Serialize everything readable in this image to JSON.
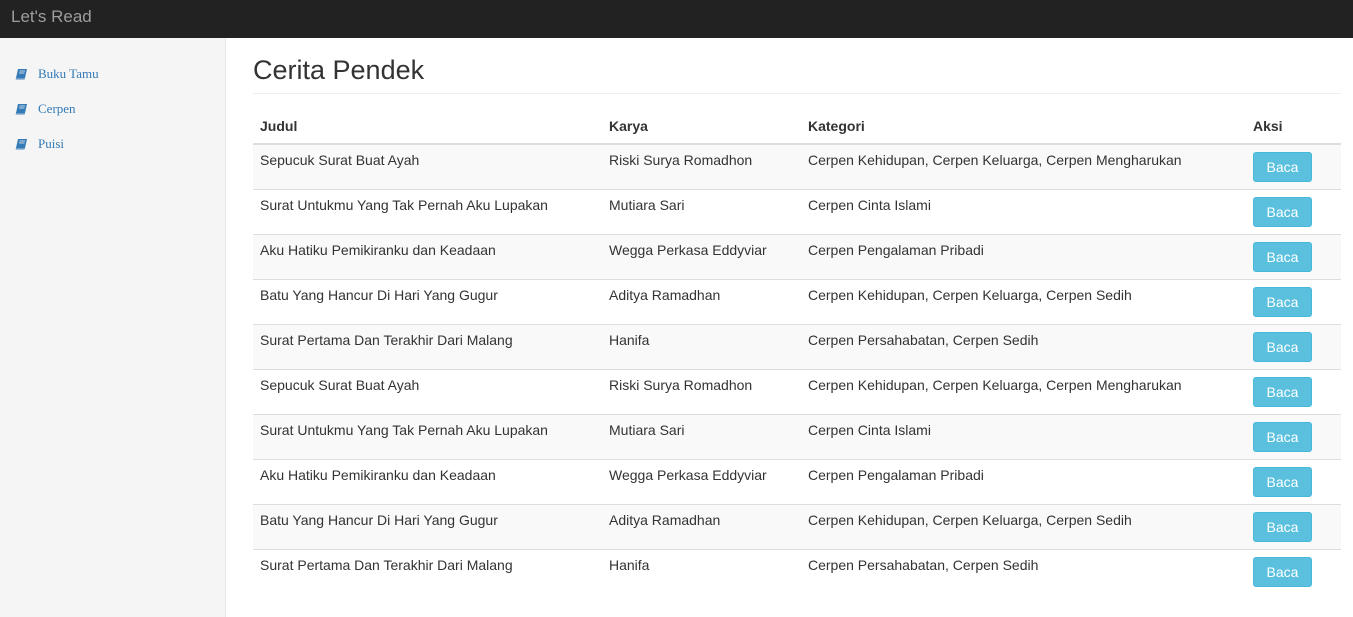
{
  "navbar": {
    "brand": "Let's Read"
  },
  "sidebar": {
    "items": [
      {
        "label": "Buku Tamu",
        "icon": "book-icon"
      },
      {
        "label": "Cerpen",
        "icon": "book-icon"
      },
      {
        "label": "Puisi",
        "icon": "book-icon"
      }
    ]
  },
  "main": {
    "title": "Cerita Pendek",
    "table": {
      "headers": {
        "judul": "Judul",
        "karya": "Karya",
        "kategori": "Kategori",
        "aksi": "Aksi"
      },
      "rows": [
        {
          "judul": "Sepucuk Surat Buat Ayah",
          "karya": "Riski Surya Romadhon",
          "kategori": "Cerpen Kehidupan, Cerpen Keluarga, Cerpen Mengharukan",
          "aksi": "Baca"
        },
        {
          "judul": "Surat Untukmu Yang Tak Pernah Aku Lupakan",
          "karya": "Mutiara Sari",
          "kategori": "Cerpen Cinta Islami",
          "aksi": "Baca"
        },
        {
          "judul": "Aku Hatiku Pemikiranku dan Keadaan",
          "karya": "Wegga Perkasa Eddyviar",
          "kategori": "Cerpen Pengalaman Pribadi",
          "aksi": "Baca"
        },
        {
          "judul": "Batu Yang Hancur Di Hari Yang Gugur",
          "karya": "Aditya Ramadhan",
          "kategori": "Cerpen Kehidupan, Cerpen Keluarga, Cerpen Sedih",
          "aksi": "Baca"
        },
        {
          "judul": "Surat Pertama Dan Terakhir Dari Malang",
          "karya": "Hanifa",
          "kategori": "Cerpen Persahabatan, Cerpen Sedih",
          "aksi": "Baca"
        },
        {
          "judul": "Sepucuk Surat Buat Ayah",
          "karya": "Riski Surya Romadhon",
          "kategori": "Cerpen Kehidupan, Cerpen Keluarga, Cerpen Mengharukan",
          "aksi": "Baca"
        },
        {
          "judul": "Surat Untukmu Yang Tak Pernah Aku Lupakan",
          "karya": "Mutiara Sari",
          "kategori": "Cerpen Cinta Islami",
          "aksi": "Baca"
        },
        {
          "judul": "Aku Hatiku Pemikiranku dan Keadaan",
          "karya": "Wegga Perkasa Eddyviar",
          "kategori": "Cerpen Pengalaman Pribadi",
          "aksi": "Baca"
        },
        {
          "judul": "Batu Yang Hancur Di Hari Yang Gugur",
          "karya": "Aditya Ramadhan",
          "kategori": "Cerpen Kehidupan, Cerpen Keluarga, Cerpen Sedih",
          "aksi": "Baca"
        },
        {
          "judul": "Surat Pertama Dan Terakhir Dari Malang",
          "karya": "Hanifa",
          "kategori": "Cerpen Persahabatan, Cerpen Sedih",
          "aksi": "Baca"
        }
      ]
    }
  },
  "colors": {
    "navbar_bg": "#222222",
    "brand_text": "#9d9d9d",
    "sidebar_bg": "#f5f5f5",
    "link": "#337ab7",
    "button_info": "#5bc0de"
  }
}
